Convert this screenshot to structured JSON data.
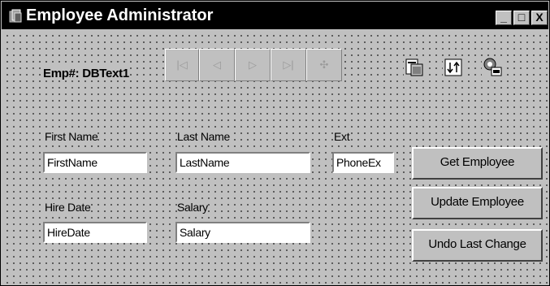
{
  "window": {
    "title": "Employee Administrator"
  },
  "titlebar_buttons": {
    "minimize": "_",
    "maximize": "□",
    "close": "X"
  },
  "emp": {
    "label": "Emp#:",
    "value": "DBText1"
  },
  "navigator": {
    "first": "|◁",
    "prior": "◁",
    "next": "▷",
    "last": "▷|",
    "insert": "✣"
  },
  "tools": [
    "data-module-icon",
    "sort-icon",
    "connect-icon"
  ],
  "fields": {
    "first_name": {
      "label": "First Name",
      "value": "FirstName"
    },
    "last_name": {
      "label": "Last Name",
      "value": "LastName"
    },
    "ext": {
      "label": "Ext",
      "value": "PhoneEx"
    },
    "hire_date": {
      "label": "Hire Date",
      "value": "HireDate"
    },
    "salary": {
      "label": "Salary",
      "value": "Salary"
    }
  },
  "buttons": {
    "get": "Get Employee",
    "update": "Update Employee",
    "undo": "Undo Last Change"
  }
}
